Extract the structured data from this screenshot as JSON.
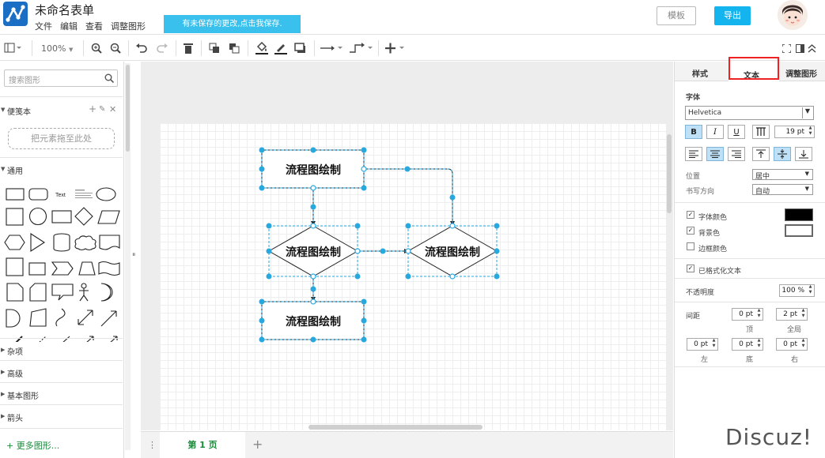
{
  "header": {
    "title": "未命名表单",
    "menu": [
      "文件",
      "编辑",
      "查看",
      "调整图形"
    ],
    "unsaved_notice": "有未保存的更改,点击我保存.",
    "template_label": "模板",
    "export_label": "导出"
  },
  "toolbar": {
    "zoom": "100%"
  },
  "sidebar": {
    "search_placeholder": "搜索图形",
    "scratchpad_label": "便笺本",
    "drop_hint": "把元素拖至此处",
    "general_label": "通用",
    "text_shape_label": "Text",
    "sections": [
      "杂项",
      "高级",
      "基本图形",
      "箭头"
    ],
    "more_shapes": "更多图形..."
  },
  "diagram": {
    "node_label": "流程图绘制"
  },
  "pages": {
    "tab_label": "第 1 页"
  },
  "panel": {
    "tabs": [
      "样式",
      "文本",
      "调整图形"
    ],
    "active_tab": "文本",
    "font_label": "字体",
    "font_family": "Helvetica",
    "font_size": "19 pt",
    "position_label": "位置",
    "position_value": "居中",
    "writing_dir_label": "书写方向",
    "writing_dir_value": "自动",
    "font_color_label": "字体颜色",
    "bg_color_label": "背景色",
    "border_color_label": "边框颜色",
    "formatted_text_label": "已格式化文本",
    "opacity_label": "不透明度",
    "opacity_value": "100 %",
    "spacing_label": "间距",
    "spacing_top": "0 pt",
    "spacing_global": "2 pt",
    "spacing_left": "0 pt",
    "spacing_bottom": "0 pt",
    "spacing_right": "0 pt",
    "top_label": "顶",
    "global_label": "全局",
    "left_label": "左",
    "bottom_label": "底",
    "right_label": "右",
    "font_color": "#000000",
    "bg_color": "#ffffff",
    "selection_color": "#29a8e0"
  },
  "watermark": "Discuz!"
}
